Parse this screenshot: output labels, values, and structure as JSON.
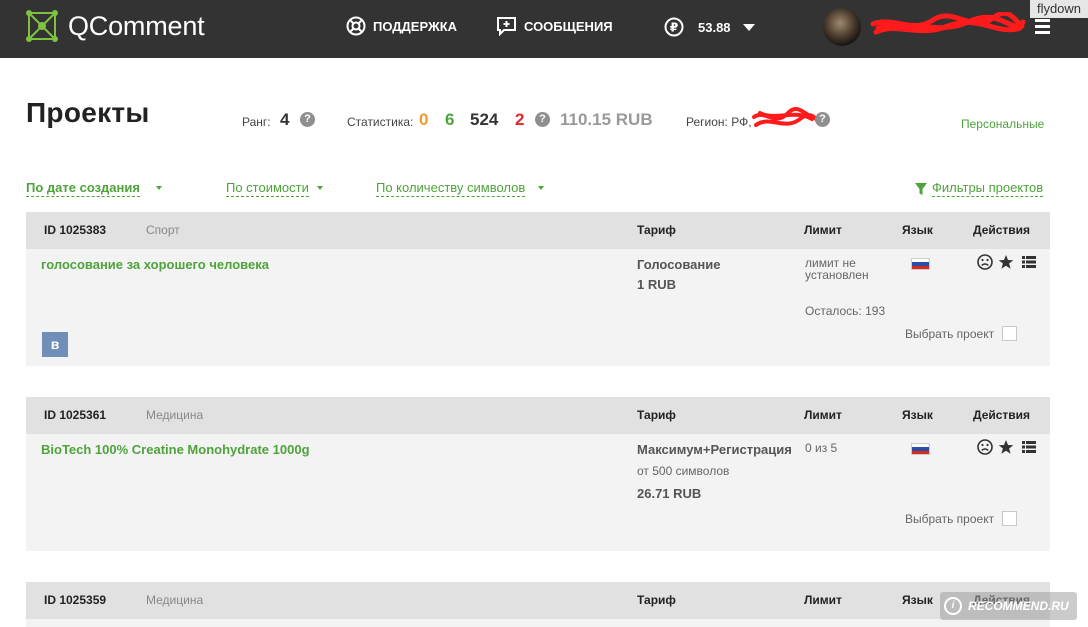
{
  "topbar": {
    "logo_text": "QComment",
    "support_label": "ПОДДЕРЖКА",
    "messages_label": "СООБЩЕНИЯ",
    "balance": "53.88",
    "username": "**************",
    "watermark": "flydown"
  },
  "header": {
    "title": "Проекты",
    "rank_label": "Ранг:",
    "rank_value": "4",
    "stats_label": "Статистика:",
    "stats": [
      {
        "value": "0",
        "color": "#f09a2e"
      },
      {
        "value": "6",
        "color": "#4ea33b"
      },
      {
        "value": "524",
        "color": "#333333"
      },
      {
        "value": "2",
        "color": "#e0272a"
      }
    ],
    "stats_money": "110.15 RUB",
    "region_label": "Регион: РФ,",
    "personal_link": "Персональные"
  },
  "sort": {
    "by_date": "По дате создания",
    "by_price": "По стоимости",
    "by_chars": "По количеству символов",
    "filters": "Фильтры проектов"
  },
  "columns": {
    "tariff": "Тариф",
    "limit": "Лимит",
    "language": "Язык",
    "actions": "Действия"
  },
  "projects": [
    {
      "id": "ID 1025383",
      "category": "Спорт",
      "name": "голосование за хорошего человека",
      "tariff": "Голосование",
      "tariff_sub": "",
      "price": "1 RUB",
      "limit_line1": "лимит не",
      "limit_line2": "установлен",
      "remaining": "Осталось: 193",
      "select_label": "Выбрать проект",
      "social": "в"
    },
    {
      "id": "ID 1025361",
      "category": "Медицина",
      "name": "BioTech 100% Creatine Monohydrate 1000g",
      "tariff": "Максимум+Регистрация",
      "tariff_sub": "от 500 символов",
      "price": "26.71 RUB",
      "limit_line1": "0 из 5",
      "limit_line2": "",
      "remaining": "",
      "select_label": "Выбрать проект",
      "social": ""
    },
    {
      "id": "ID 1025359",
      "category": "Медицина"
    }
  ],
  "watermark_bottom": "RECOMMEND.RU",
  "colors": {
    "topbar": "#333333",
    "accent_green": "#4ea33b",
    "card_bg": "#f3f3f3",
    "card_head_bg": "#e1e1e1"
  }
}
